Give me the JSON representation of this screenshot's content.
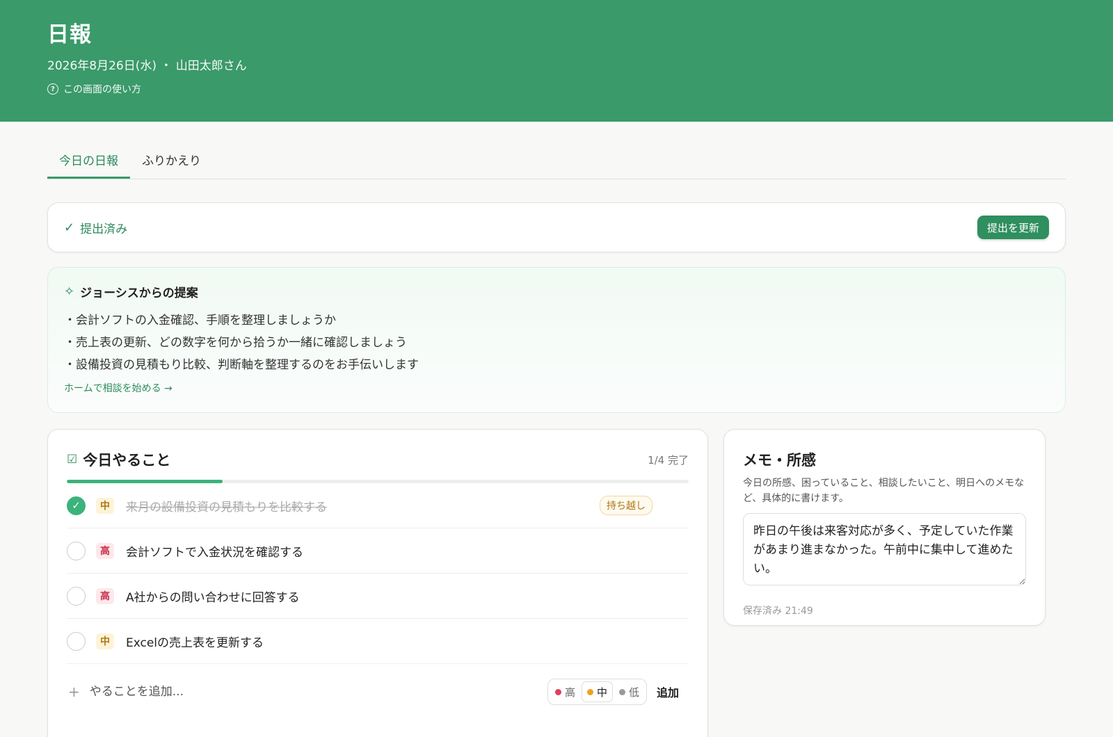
{
  "header": {
    "title": "日報",
    "subtitle": "2026年8月26日(水) ・ 山田太郎さん",
    "help_label": "この画面の使い方"
  },
  "tabs": [
    {
      "label": "今日の日報",
      "active": true
    },
    {
      "label": "ふりかえり",
      "active": false
    }
  ],
  "status": {
    "label": "提出済み",
    "button_label": "提出を更新"
  },
  "suggestions": {
    "title": "ジョーシスからの提案",
    "items": [
      "・会計ソフトの入金確認、手順を整理しましょうか",
      "・売上表の更新、どの数字を何から拾うか一緒に確認しましょう",
      "・設備投資の見積もり比較、判断軸を整理するのをお手伝いします"
    ],
    "link_label": "ホームで相談を始める →"
  },
  "todo": {
    "title": "今日やること",
    "count_label": "1/4 完了",
    "progress": 0.25,
    "tasks": [
      {
        "priority": "中",
        "text": "来月の設備投資の見積もりを比較する",
        "done": true,
        "badge": "持ち越し"
      },
      {
        "priority": "高",
        "text": "会計ソフトで入金状況を確認する",
        "done": false
      },
      {
        "priority": "高",
        "text": "A社からの問い合わせに回答する",
        "done": false
      },
      {
        "priority": "中",
        "text": "Excelの売上表を更新する",
        "done": false
      }
    ],
    "add_placeholder": "やることを追加...",
    "priority_options": [
      {
        "label": "高",
        "color": "#e0405a"
      },
      {
        "label": "中",
        "color": "#f0a020",
        "selected": true
      },
      {
        "label": "低",
        "color": "#999999"
      }
    ],
    "add_button_label": "追加"
  },
  "memo": {
    "title": "メモ・所感",
    "description": "今日の所感、困っていること、相談したいこと、明日へのメモなど、具体的に書けます。",
    "content": "昨日の午後は来客対応が多く、予定していた作業があまり進まなかった。午前中に集中して進めたい。",
    "saved_label": "保存済み 21:49"
  },
  "colors": {
    "brand": "#3a9a6a",
    "accent": "#2d8a5c",
    "progress": "#3cb37a"
  }
}
